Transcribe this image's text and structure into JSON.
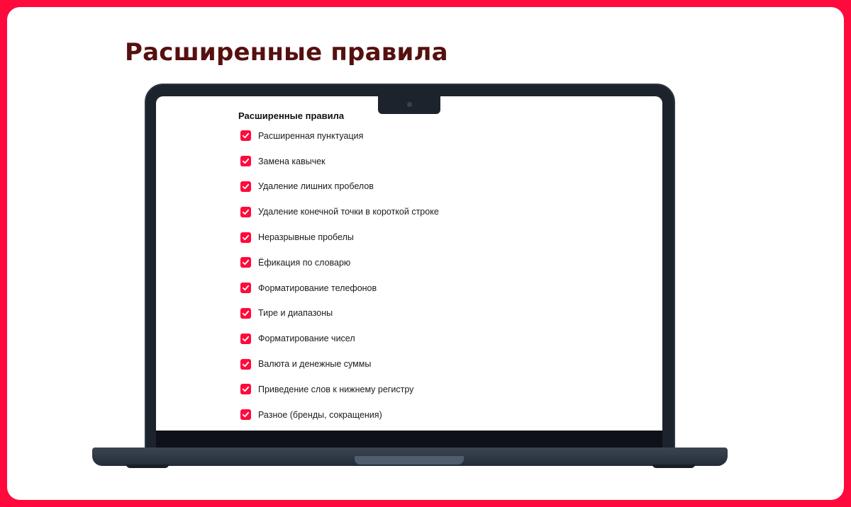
{
  "page": {
    "heading": "Расширенные правила"
  },
  "settings": {
    "title": "Расширенные правила",
    "rules": [
      {
        "label": "Расширенная пунктуация",
        "checked": true
      },
      {
        "label": "Замена кавычек",
        "checked": true
      },
      {
        "label": "Удаление лишних пробелов",
        "checked": true
      },
      {
        "label": "Удаление конечной точки в короткой строке",
        "checked": true
      },
      {
        "label": "Неразрывные пробелы",
        "checked": true
      },
      {
        "label": "Ёфикация по словарю",
        "checked": true
      },
      {
        "label": "Форматирование телефонов",
        "checked": true
      },
      {
        "label": "Тире и диапазоны",
        "checked": true
      },
      {
        "label": "Форматирование чисел",
        "checked": true
      },
      {
        "label": "Валюта и денежные суммы",
        "checked": true
      },
      {
        "label": "Приведение слов к нижнему регистру",
        "checked": true
      },
      {
        "label": "Разное (бренды, сокращения)",
        "checked": true
      }
    ]
  },
  "colors": {
    "accent": "#ff0a3c",
    "heading": "#55100f",
    "laptop": "#1d232c"
  },
  "icons": {
    "checkbox_mark": "checkmark-icon"
  }
}
